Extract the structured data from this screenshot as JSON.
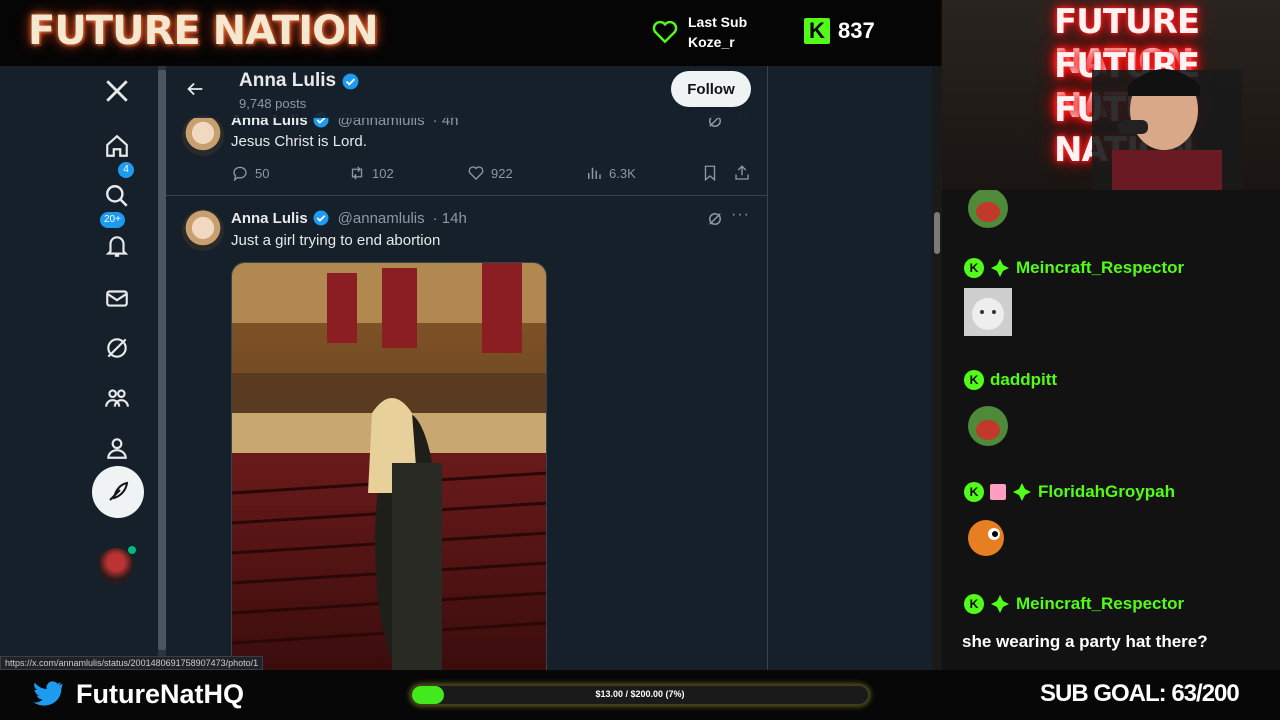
{
  "overlay": {
    "brand": "FUTURE NATION",
    "last_sub_label": "Last Sub",
    "last_sub_name": "Koze_r",
    "kick_count": "837",
    "twitter_handle": "FutureNatHQ",
    "goal_text": "$13.00 / $200.00 (7%)",
    "goal_progress": 0.07,
    "sub_goal": "SUB GOAL: 63/200",
    "cam_sign": [
      "FUTURE NATION",
      "FUTURE NATION",
      "FUTURE NATION"
    ],
    "colors": {
      "kick_green": "#53fc18",
      "x_blue": "#1d9bf0",
      "neon_red": "#ff2020"
    }
  },
  "sidebar": {
    "items": [
      {
        "name": "x-logo-icon"
      },
      {
        "name": "home-icon"
      },
      {
        "name": "search-icon"
      },
      {
        "name": "notifications-icon",
        "badge": "4"
      },
      {
        "name": "messages-icon",
        "badge": "20+"
      },
      {
        "name": "grok-icon"
      },
      {
        "name": "communities-icon"
      },
      {
        "name": "profile-icon"
      },
      {
        "name": "more-icon"
      }
    ],
    "post_button": "feather-icon"
  },
  "profile": {
    "name": "Anna Lulis",
    "posts_count": "9,748 posts",
    "follow_label": "Follow"
  },
  "tweets": [
    {
      "name": "Anna Lulis",
      "handle": "@annamlulis",
      "time": "· 4h",
      "text": "Jesus Christ is Lord.",
      "replies": "50",
      "reposts": "102",
      "likes": "922",
      "views": "6.3K"
    },
    {
      "name": "Anna Lulis",
      "handle": "@annamlulis",
      "time": "· 14h",
      "text": "Just a girl trying to end abortion"
    }
  ],
  "status_url": "https://x.com/annamlulis/status/2001480691758907473/photo/1",
  "chat": {
    "messages": [
      {
        "user": "Meincraft_Respector",
        "emote": "cat-emote"
      },
      {
        "user": "daddpitt",
        "emote": "pepe-scream-emote"
      },
      {
        "user": "FloridahGroypah",
        "emote": "pepe-orange-emote"
      },
      {
        "user": "Meincraft_Respector",
        "text": "she wearing a party hat there?"
      }
    ]
  }
}
